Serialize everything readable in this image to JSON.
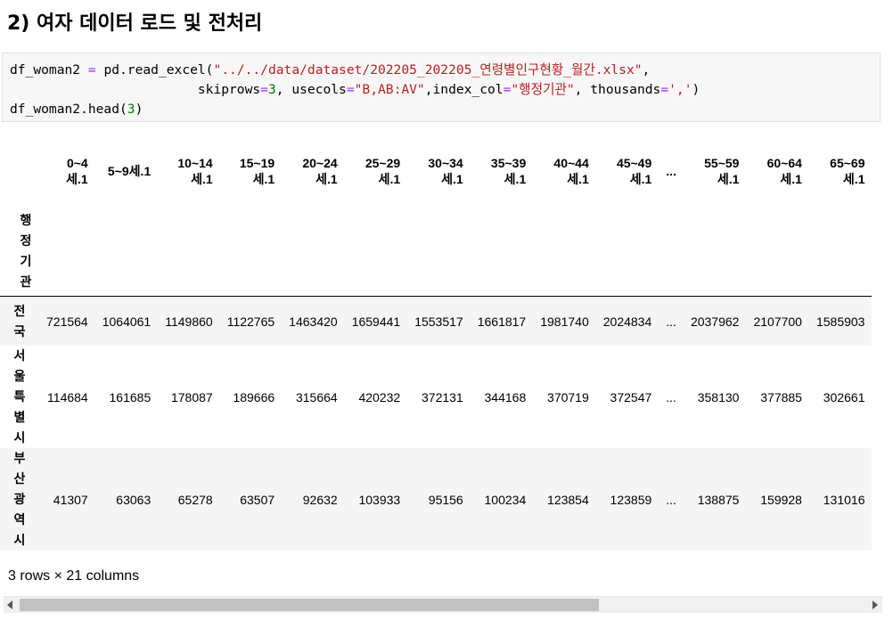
{
  "heading": "2) 여자 데이터 로드 및 전처리",
  "code": {
    "l1_a": "df_woman2 ",
    "l1_op": "=",
    "l1_b": " pd.read_excel(",
    "l1_str": "\"../../data/dataset/202205_202205_연령별인구현황_월간.xlsx\"",
    "l1_c": ",",
    "l2_a": "                        skiprows",
    "l2_op1": "=",
    "l2_num": "3",
    "l2_b": ", usecols",
    "l2_op2": "=",
    "l2_str1": "\"B,AB:AV\"",
    "l2_c": ",index_col",
    "l2_op3": "=",
    "l2_str2": "\"행정기관\"",
    "l2_d": ", thousands",
    "l2_op4": "=",
    "l2_str3": "','",
    "l2_e": ")",
    "l3_a": "df_woman2.head(",
    "l3_num": "3",
    "l3_b": ")"
  },
  "table": {
    "columns": [
      [
        "0~4",
        "세.1"
      ],
      [
        "5~9세.1"
      ],
      [
        "10~14",
        "세.1"
      ],
      [
        "15~19",
        "세.1"
      ],
      [
        "20~24",
        "세.1"
      ],
      [
        "25~29",
        "세.1"
      ],
      [
        "30~34",
        "세.1"
      ],
      [
        "35~39",
        "세.1"
      ],
      [
        "40~44",
        "세.1"
      ],
      [
        "45~49",
        "세.1"
      ],
      [
        "..."
      ],
      [
        "55~59",
        "세.1"
      ],
      [
        "60~64",
        "세.1"
      ],
      [
        "65~69",
        "세.1"
      ]
    ],
    "index_name": [
      "행",
      "정",
      "기",
      "관"
    ],
    "rows": [
      {
        "label": [
          "전",
          "국"
        ],
        "values": [
          "721564",
          "1064061",
          "1149860",
          "1122765",
          "1463420",
          "1659441",
          "1553517",
          "1661817",
          "1981740",
          "2024834",
          "...",
          "2037962",
          "2107700",
          "1585903"
        ]
      },
      {
        "label": [
          "서",
          "울",
          "특",
          "별",
          "시"
        ],
        "values": [
          "114684",
          "161685",
          "178087",
          "189666",
          "315664",
          "420232",
          "372131",
          "344168",
          "370719",
          "372547",
          "...",
          "358130",
          "377885",
          "302661"
        ]
      },
      {
        "label": [
          "부",
          "산",
          "광",
          "역",
          "시"
        ],
        "values": [
          "41307",
          "63063",
          "65278",
          "63507",
          "92632",
          "103933",
          "95156",
          "100234",
          "123854",
          "123859",
          "...",
          "138875",
          "159928",
          "131016"
        ]
      }
    ]
  },
  "footer": "3 rows × 21 columns"
}
